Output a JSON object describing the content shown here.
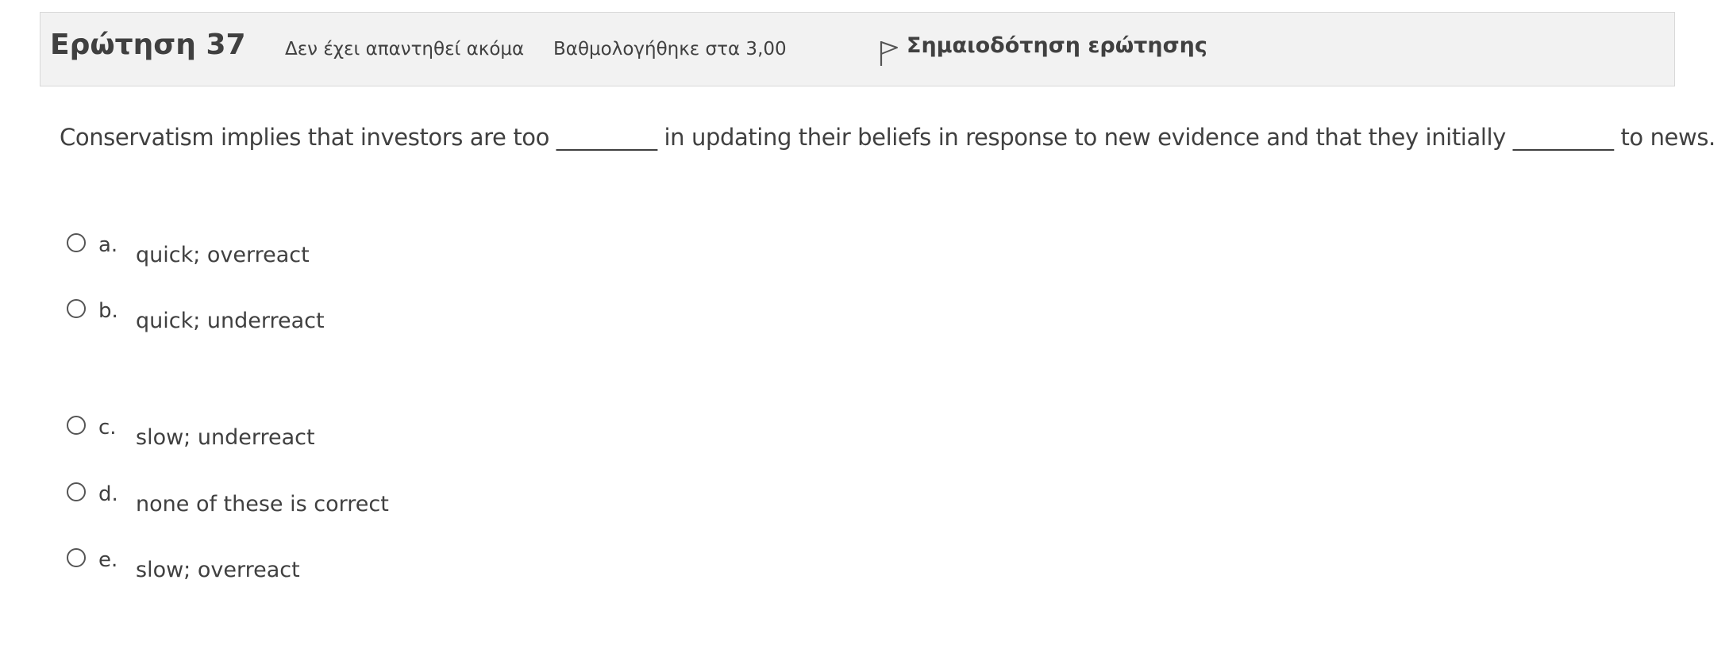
{
  "info": {
    "title": "Ερώτηση 37",
    "state": "Δεν έχει απαντηθεί ακόμα",
    "grade": "Βαθμολογήθηκε στα 3,00",
    "flag_label": "Σημαιοδότηση ερώτησης",
    "flag_icon": "flag-icon"
  },
  "question": {
    "text": "Conservatism implies that investors are too _________ in updating their beliefs in response to new evidence and that they initially _________ to news."
  },
  "options": [
    {
      "letter": "a.",
      "text": "quick; overreact",
      "selected": false
    },
    {
      "letter": "b.",
      "text": "quick; underreact",
      "selected": false
    },
    {
      "letter": "c.",
      "text": "slow; underreact",
      "selected": false
    },
    {
      "letter": "d.",
      "text": "none of these is correct",
      "selected": false
    },
    {
      "letter": "e.",
      "text": "slow; overreact",
      "selected": false
    }
  ]
}
